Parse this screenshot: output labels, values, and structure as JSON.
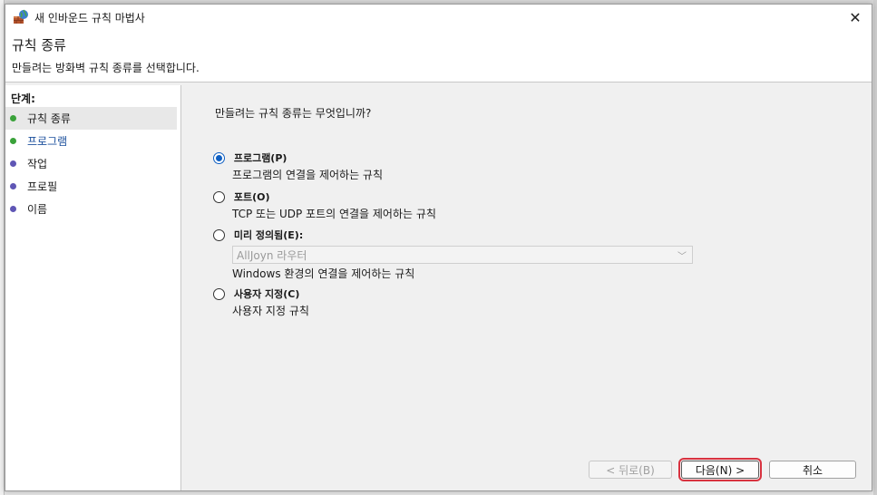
{
  "window": {
    "title": "새 인바운드 규칙 마법사"
  },
  "header": {
    "title": "규칙 종류",
    "subtitle": "만들려는 방화벽 규칙 종류를 선택합니다."
  },
  "steps": {
    "title": "단계:",
    "items": [
      {
        "label": "규칙 종류",
        "state": "current",
        "color": "#3aa23a"
      },
      {
        "label": "프로그램",
        "state": "link",
        "color": "#3aa23a"
      },
      {
        "label": "작업",
        "state": "normal",
        "color": "#5f56b5"
      },
      {
        "label": "프로필",
        "state": "normal",
        "color": "#5f56b5"
      },
      {
        "label": "이름",
        "state": "normal",
        "color": "#5f56b5"
      }
    ]
  },
  "content": {
    "question": "만들려는 규칙 종류는 무엇입니까?",
    "options": [
      {
        "label": "프로그램(P)",
        "desc": "프로그램의 연결을 제어하는 규칙",
        "checked": true
      },
      {
        "label": "포트(O)",
        "desc": "TCP 또는 UDP 포트의 연결을 제어하는 규칙",
        "checked": false
      },
      {
        "label": "미리 정의됨(E):",
        "select_value": "AllJoyn 라우터",
        "desc": "Windows 환경의 연결을 제어하는 규칙",
        "checked": false
      },
      {
        "label": "사용자 지정(C)",
        "desc": "사용자 지정 규칙",
        "checked": false
      }
    ]
  },
  "buttons": {
    "back": "< 뒤로(B)",
    "next": "다음(N) >",
    "cancel": "취소"
  },
  "colors": {
    "accent": "#0f5fc2",
    "focus_outline": "#d8323f"
  }
}
